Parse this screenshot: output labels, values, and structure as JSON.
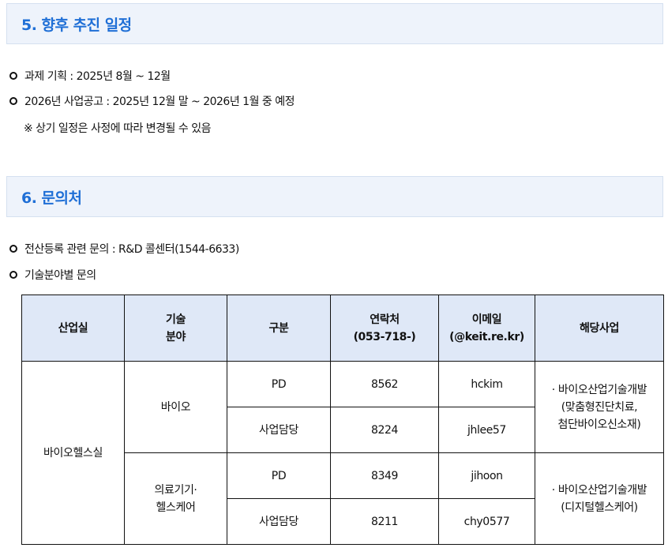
{
  "section5": {
    "title": "5. 향후 추진 일정",
    "items": [
      "과제 기획 : 2025년 8월 ~ 12월",
      "2026년 사업공고 : 2025년 12월 말 ~ 2026년 1월 중 예정"
    ],
    "note": "※ 상기 일정은 사정에 따라 변경될 수 있음"
  },
  "section6": {
    "title": "6. 문의처",
    "items": [
      "전산등록 관련 문의 : R&D 콜센터(1544-6633)",
      "기술분야별 문의"
    ]
  },
  "table": {
    "headers": {
      "dept": "산업실",
      "field_1": "기술",
      "field_2": "분야",
      "type": "구분",
      "contact_1": "연락처",
      "contact_2": "(053-718-)",
      "email_1": "이메일",
      "email_2": "(@keit.re.kr)",
      "program": "해당사업"
    },
    "dept": "바이오헬스실",
    "groups": [
      {
        "field_1": "바이오",
        "field_2": "",
        "rows": [
          {
            "type": "PD",
            "ext": "8562",
            "email": "hckim"
          },
          {
            "type": "사업담당",
            "ext": "8224",
            "email": "jhlee57"
          }
        ],
        "program": [
          "· 바이오산업기술개발",
          "(맞춤형진단치료,",
          "첨단바이오신소재)"
        ]
      },
      {
        "field_1": "의료기기·",
        "field_2": "헬스케어",
        "rows": [
          {
            "type": "PD",
            "ext": "8349",
            "email": "jihoon"
          },
          {
            "type": "사업담당",
            "ext": "8211",
            "email": "chy0577"
          }
        ],
        "program": [
          "· 바이오산업기술개발",
          "(디지털헬스케어)",
          ""
        ]
      }
    ]
  }
}
